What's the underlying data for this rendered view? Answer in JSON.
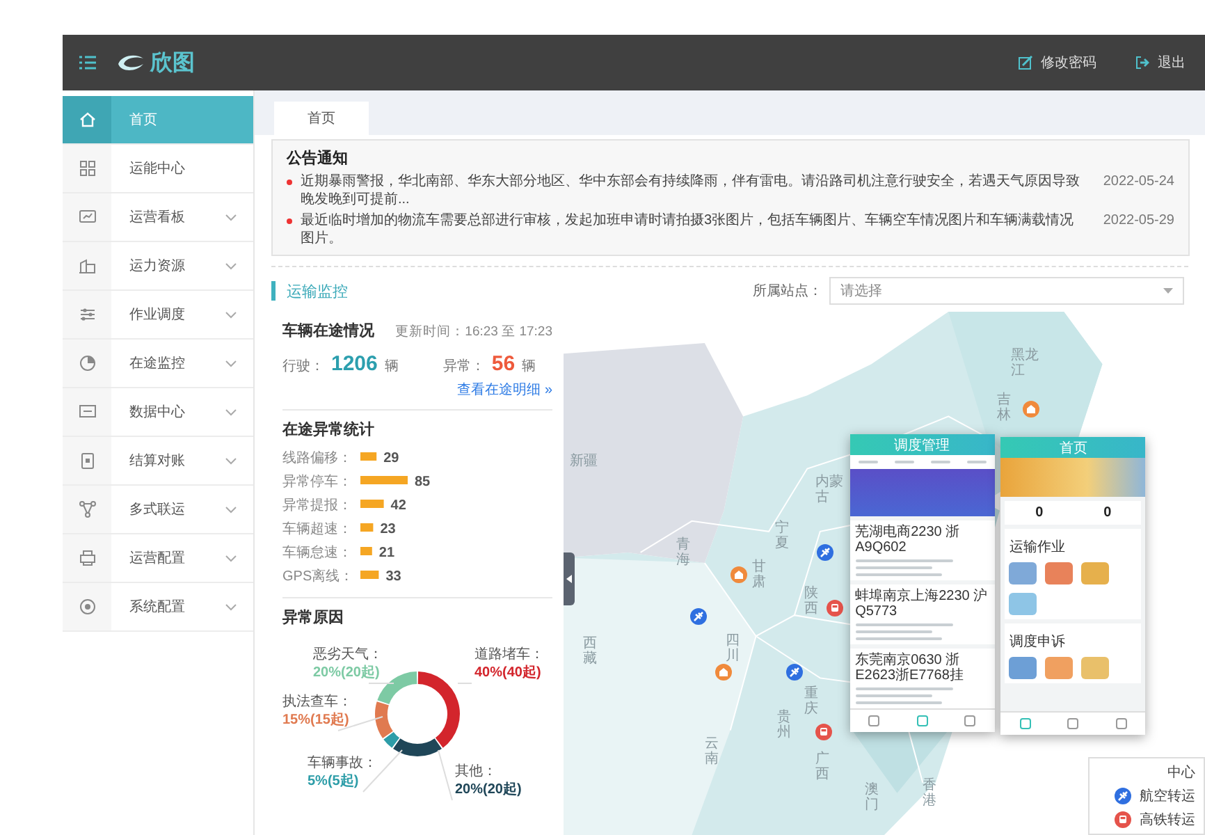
{
  "topbar": {
    "brand": "欣图",
    "actions": [
      {
        "kind": "edit",
        "label": "修改密码"
      },
      {
        "kind": "logout",
        "label": "退出"
      }
    ]
  },
  "sidebar": {
    "items": [
      {
        "label": "首页",
        "selected": true,
        "has_submenu": false
      },
      {
        "label": "运能中心",
        "selected": false,
        "has_submenu": false
      },
      {
        "label": "运营看板",
        "selected": false,
        "has_submenu": true
      },
      {
        "label": "运力资源",
        "selected": false,
        "has_submenu": true
      },
      {
        "label": "作业调度",
        "selected": false,
        "has_submenu": true
      },
      {
        "label": "在途监控",
        "selected": false,
        "has_submenu": true
      },
      {
        "label": "数据中心",
        "selected": false,
        "has_submenu": true
      },
      {
        "label": "结算对账",
        "selected": false,
        "has_submenu": true
      },
      {
        "label": "多式联运",
        "selected": false,
        "has_submenu": true
      },
      {
        "label": "运营配置",
        "selected": false,
        "has_submenu": true
      },
      {
        "label": "系统配置",
        "selected": false,
        "has_submenu": true
      }
    ]
  },
  "tabs": [
    {
      "label": "首页",
      "selected": true
    }
  ],
  "notice": {
    "title": "公告通知",
    "items": [
      {
        "text": "近期暴雨警报，华北南部、华东大部分地区、华中东部会有持续降雨，伴有雷电。请沿路司机注意行驶安全，若遇天气原因导致晚发晚到可提前...",
        "date": "2022-05-24"
      },
      {
        "text": "最近临时增加的物流车需要总部进行审核，发起加班申请时请拍摄3张图片，包括车辆图片、车辆空车情况图片和车辆满载情况图片。",
        "date": "2022-05-29"
      }
    ]
  },
  "monitor": {
    "title": "运输监控",
    "station_label": "所属站点：",
    "station_select": {
      "placeholder": "请选择"
    }
  },
  "vehicles": {
    "title": "车辆在途情况",
    "update_time": "更新时间：16:23 至 17:23",
    "running_label": "行驶：",
    "running_count": "1206",
    "running_unit": "辆",
    "abnormal_label": "异常：",
    "abnormal_count": "56",
    "abnormal_unit": "辆",
    "detail_link": "查看在途明细",
    "detail_arrow": "»"
  },
  "anomaly_stats": {
    "title": "在途异常统计",
    "separator": "：",
    "chart_data": {
      "type": "bar",
      "orientation": "horizontal",
      "categories": [
        "线路偏移",
        "异常停车",
        "异常提报",
        "车辆超速",
        "车辆怠速",
        "GPS离线"
      ],
      "values": [
        29,
        85,
        42,
        23,
        21,
        33
      ],
      "data_labels": true
    }
  },
  "anomaly_reasons": {
    "title": "异常原因",
    "separator": "：",
    "chart_data": {
      "type": "donut",
      "categories": [
        "道路堵车",
        "其他",
        "车辆事故",
        "执法查车",
        "恶劣天气"
      ],
      "values": [
        40,
        20,
        5,
        15,
        20
      ],
      "value_labels": [
        "40%(40起)",
        "20%(20起)",
        "5%(5起)",
        "15%(15起)",
        "20%(20起)"
      ],
      "colors": [
        "#d3252c",
        "#1f4658",
        "#2d9da8",
        "#e07a50",
        "#7dcaa4"
      ]
    }
  },
  "map": {
    "labels": [
      "新疆",
      "西藏",
      "青海",
      "甘肃",
      "宁夏",
      "内蒙古",
      "陕西",
      "四川",
      "重庆",
      "贵州",
      "云南",
      "广西",
      "澳门",
      "香港",
      "黑龙江",
      "吉林"
    ],
    "legend": [
      {
        "kind": "cut",
        "label": "中心"
      },
      {
        "kind": "air",
        "label": "航空转运"
      },
      {
        "kind": "rail",
        "label": "高铁转运"
      }
    ]
  },
  "phones": [
    {
      "kind": "dispatch",
      "title": "调度管理",
      "cards": [
        "芜湖电商2230 浙A9Q602",
        "蚌埠南京上海2230 沪Q5773",
        "东莞南京0630 浙E2623浙E7768挂"
      ]
    },
    {
      "kind": "home",
      "title": "首页",
      "counts": [
        "0",
        "0"
      ],
      "sections": [
        "运输作业",
        "调度申诉"
      ]
    }
  ]
}
